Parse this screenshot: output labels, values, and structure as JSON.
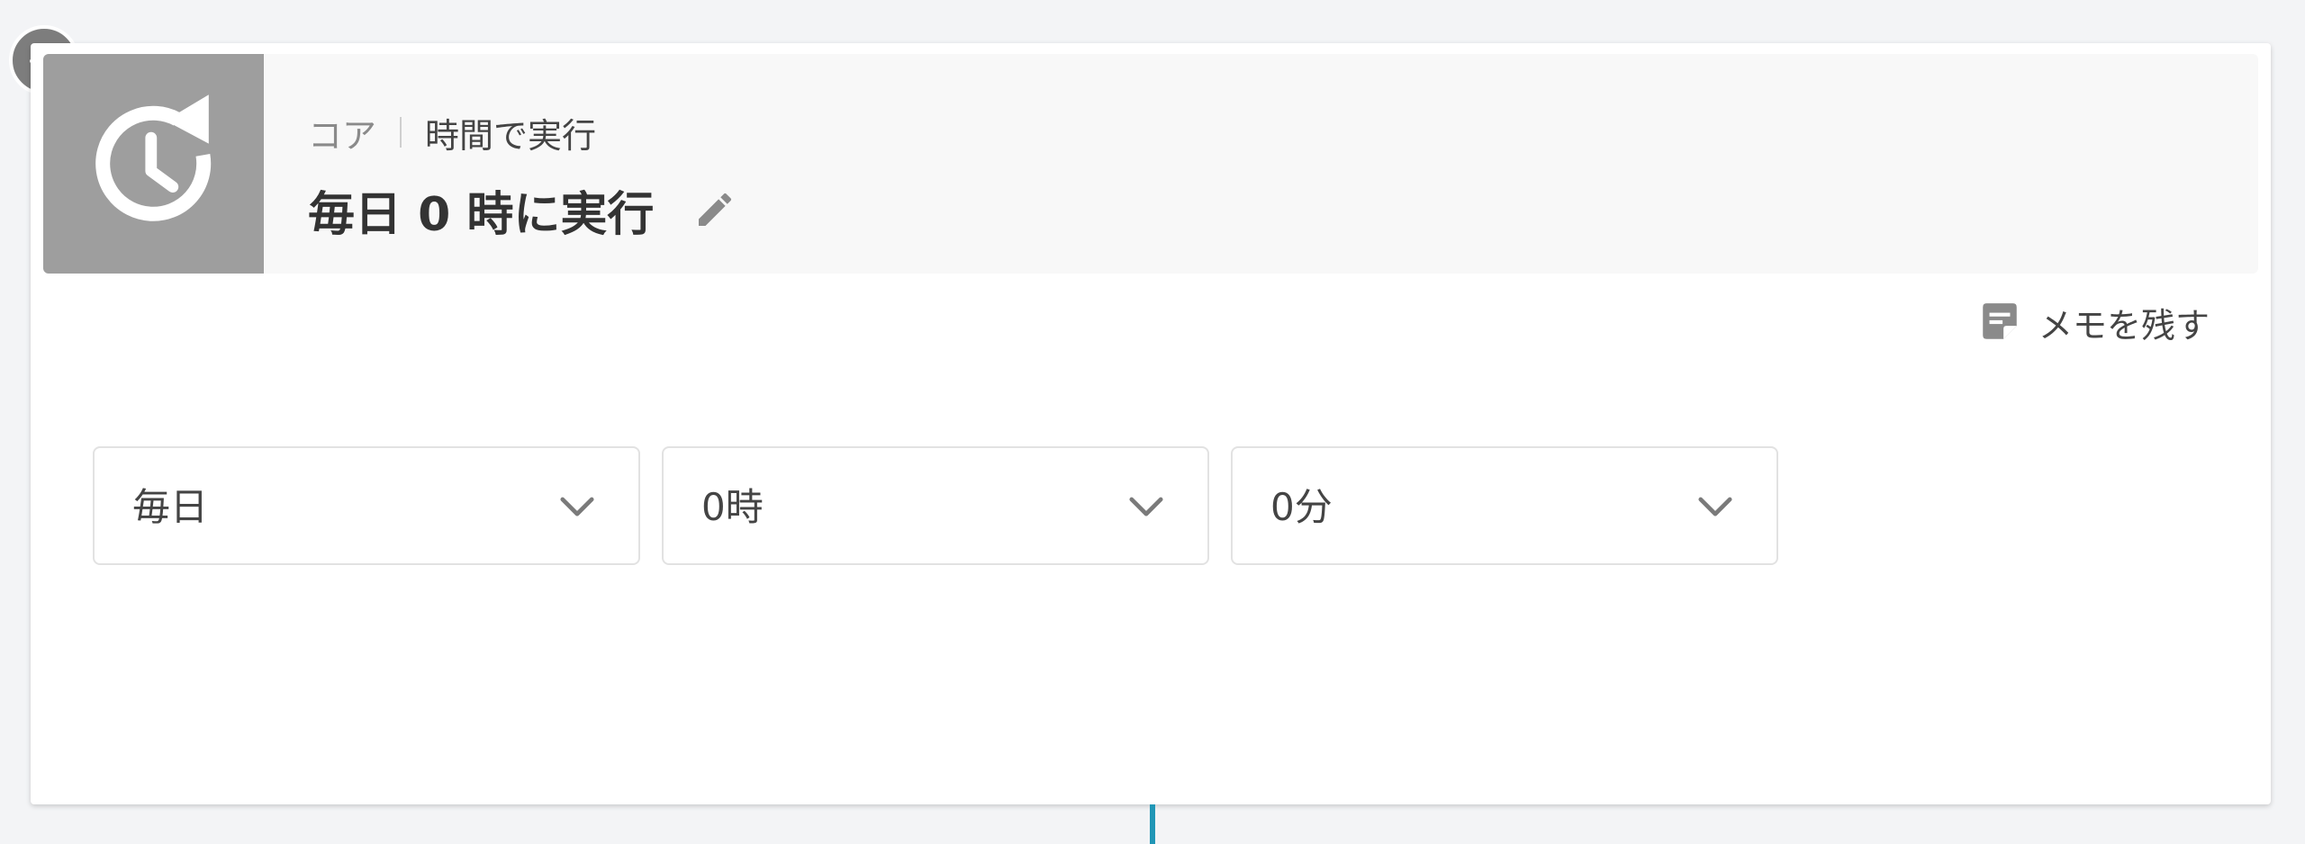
{
  "header": {
    "category": "コア",
    "type": "時間で実行",
    "title": "毎日 0 時に実行",
    "icon": "clock-refresh-icon",
    "edit_icon": "pencil-icon"
  },
  "memo_button": {
    "label": "メモを残す",
    "icon": "memo-icon"
  },
  "schedule": {
    "frequency": "毎日",
    "hour": "0時",
    "minute": "0分"
  },
  "status": {
    "icon": "check-icon"
  },
  "colors": {
    "icon_bg": "#9e9e9e",
    "badge_bg": "#7d7d7d",
    "connector": "#2196b6"
  }
}
